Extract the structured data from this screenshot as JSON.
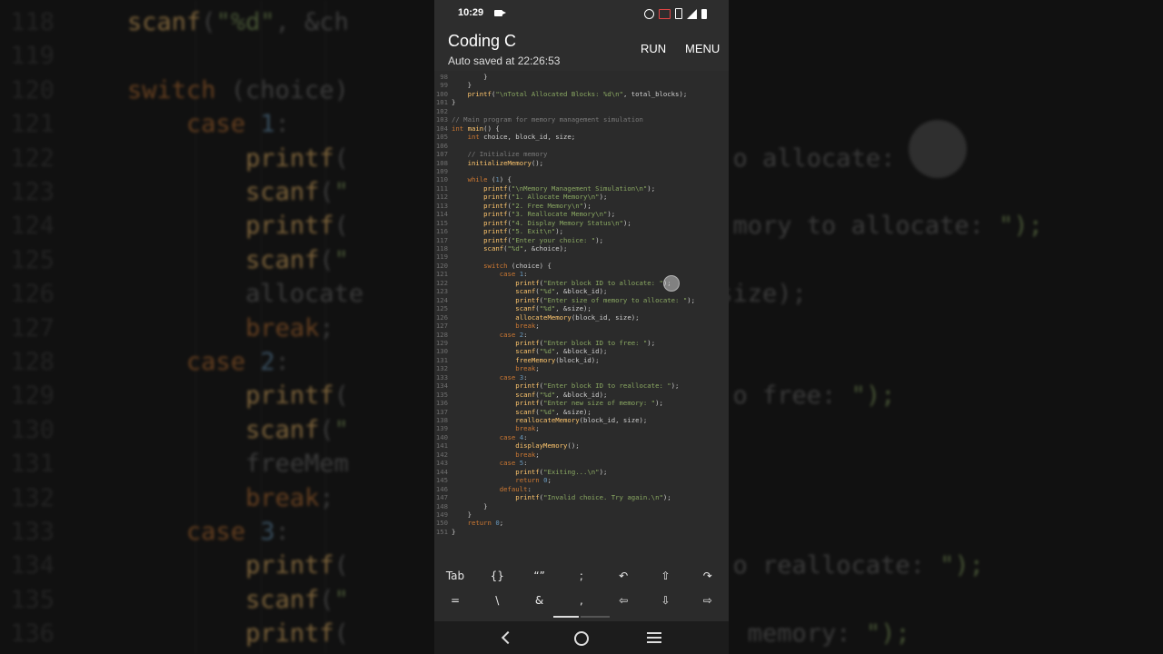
{
  "background_code": {
    "lines": [
      {
        "n": "118",
        "t": "    scanf(\"%d\", &ch"
      },
      {
        "n": "119",
        "t": ""
      },
      {
        "n": "120",
        "t": "    switch (choice)"
      },
      {
        "n": "121",
        "t": "        case 1:"
      },
      {
        "n": "122",
        "t": "            printf(                          o allocate: "
      },
      {
        "n": "123",
        "t": "            scanf(\""
      },
      {
        "n": "124",
        "t": "            printf(                          mory to allocate: \");"
      },
      {
        "n": "125",
        "t": "            scanf(\""
      },
      {
        "n": "126",
        "t": "            allocate                        size);"
      },
      {
        "n": "127",
        "t": "            break;"
      },
      {
        "n": "128",
        "t": "        case 2:"
      },
      {
        "n": "129",
        "t": "            printf(                          o free: \");"
      },
      {
        "n": "130",
        "t": "            scanf(\""
      },
      {
        "n": "131",
        "t": "            freeMem"
      },
      {
        "n": "132",
        "t": "            break;"
      },
      {
        "n": "133",
        "t": "        case 3:"
      },
      {
        "n": "134",
        "t": "            printf(                          o reallocate: \");"
      },
      {
        "n": "135",
        "t": "            scanf(\""
      },
      {
        "n": "136",
        "t": "            printf(                           memory: \");"
      }
    ]
  },
  "status_bar": {
    "time": "10:29"
  },
  "app_bar": {
    "title": "Coding C",
    "subtitle": "Auto saved at 22:26:53",
    "run_label": "RUN",
    "menu_label": "MENU"
  },
  "editor": {
    "lines": [
      {
        "n": "98",
        "t": "        }"
      },
      {
        "n": "99",
        "t": "    }"
      },
      {
        "n": "100",
        "t": "    printf(\"\\nTotal Allocated Blocks: %d\\n\", total_blocks);"
      },
      {
        "n": "101",
        "t": "}"
      },
      {
        "n": "102",
        "t": ""
      },
      {
        "n": "103",
        "t": "// Main program for memory management simulation"
      },
      {
        "n": "104",
        "t": "int main() {"
      },
      {
        "n": "105",
        "t": "    int choice, block_id, size;"
      },
      {
        "n": "106",
        "t": ""
      },
      {
        "n": "107",
        "t": "    // Initialize memory"
      },
      {
        "n": "108",
        "t": "    initializeMemory();"
      },
      {
        "n": "109",
        "t": ""
      },
      {
        "n": "110",
        "t": "    while (1) {"
      },
      {
        "n": "111",
        "t": "        printf(\"\\nMemory Management Simulation\\n\");"
      },
      {
        "n": "112",
        "t": "        printf(\"1. Allocate Memory\\n\");"
      },
      {
        "n": "113",
        "t": "        printf(\"2. Free Memory\\n\");"
      },
      {
        "n": "114",
        "t": "        printf(\"3. Reallocate Memory\\n\");"
      },
      {
        "n": "115",
        "t": "        printf(\"4. Display Memory Status\\n\");"
      },
      {
        "n": "116",
        "t": "        printf(\"5. Exit\\n\");"
      },
      {
        "n": "117",
        "t": "        printf(\"Enter your choice: \");"
      },
      {
        "n": "118",
        "t": "        scanf(\"%d\", &choice);"
      },
      {
        "n": "119",
        "t": ""
      },
      {
        "n": "120",
        "t": "        switch (choice) {"
      },
      {
        "n": "121",
        "t": "            case 1:"
      },
      {
        "n": "122",
        "t": "                printf(\"Enter block ID to allocate: \");"
      },
      {
        "n": "123",
        "t": "                scanf(\"%d\", &block_id);"
      },
      {
        "n": "124",
        "t": "                printf(\"Enter size of memory to allocate: \");"
      },
      {
        "n": "125",
        "t": "                scanf(\"%d\", &size);"
      },
      {
        "n": "126",
        "t": "                allocateMemory(block_id, size);"
      },
      {
        "n": "127",
        "t": "                break;"
      },
      {
        "n": "128",
        "t": "            case 2:"
      },
      {
        "n": "129",
        "t": "                printf(\"Enter block ID to free: \");"
      },
      {
        "n": "130",
        "t": "                scanf(\"%d\", &block_id);"
      },
      {
        "n": "131",
        "t": "                freeMemory(block_id);"
      },
      {
        "n": "132",
        "t": "                break;"
      },
      {
        "n": "133",
        "t": "            case 3:"
      },
      {
        "n": "134",
        "t": "                printf(\"Enter block ID to reallocate: \");"
      },
      {
        "n": "135",
        "t": "                scanf(\"%d\", &block_id);"
      },
      {
        "n": "136",
        "t": "                printf(\"Enter new size of memory: \");"
      },
      {
        "n": "137",
        "t": "                scanf(\"%d\", &size);"
      },
      {
        "n": "138",
        "t": "                reallocateMemory(block_id, size);"
      },
      {
        "n": "139",
        "t": "                break;"
      },
      {
        "n": "140",
        "t": "            case 4:"
      },
      {
        "n": "141",
        "t": "                displayMemory();"
      },
      {
        "n": "142",
        "t": "                break;"
      },
      {
        "n": "143",
        "t": "            case 5:"
      },
      {
        "n": "144",
        "t": "                printf(\"Exiting...\\n\");"
      },
      {
        "n": "145",
        "t": "                return 0;"
      },
      {
        "n": "146",
        "t": "            default:"
      },
      {
        "n": "147",
        "t": "                printf(\"Invalid choice. Try again.\\n\");"
      },
      {
        "n": "148",
        "t": "        }"
      },
      {
        "n": "149",
        "t": "    }"
      },
      {
        "n": "150",
        "t": "    return 0;"
      },
      {
        "n": "151",
        "t": "}"
      }
    ]
  },
  "keyboard": {
    "row1": [
      {
        "label": "Tab",
        "name": "tab-key"
      },
      {
        "label": "{}",
        "name": "braces-key"
      },
      {
        "label": "“”",
        "name": "quotes-key"
      },
      {
        "label": ";",
        "name": "semicolon-key"
      },
      {
        "label": "↶",
        "name": "undo-key"
      },
      {
        "label": "⇧",
        "name": "shift-up-key"
      },
      {
        "label": "↷",
        "name": "redo-key"
      }
    ],
    "row2": [
      {
        "label": "=",
        "name": "equals-key"
      },
      {
        "label": "\\",
        "name": "backslash-key"
      },
      {
        "label": "&",
        "name": "ampersand-key"
      },
      {
        "label": ",",
        "name": "comma-key"
      },
      {
        "label": "⇦",
        "name": "arrow-left-key"
      },
      {
        "label": "⇩",
        "name": "arrow-down-key"
      },
      {
        "label": "⇨",
        "name": "arrow-right-key"
      }
    ]
  },
  "navigation": {
    "icons": [
      "back-icon",
      "home-icon",
      "recents-icon"
    ]
  },
  "colors": {
    "keyword": "#cc7832",
    "function": "#ffc66d",
    "string": "#8aa862",
    "comment": "#7a7a7a",
    "text": "#cfcfcf",
    "editor_bg": "#2b2b2b"
  }
}
